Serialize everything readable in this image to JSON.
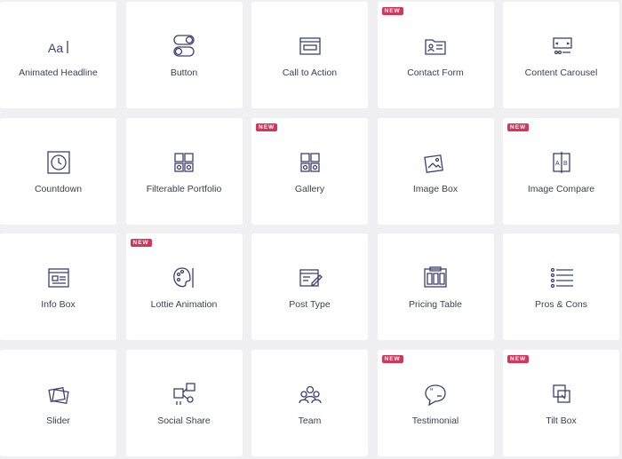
{
  "badge_text": "NEW",
  "accent_color": "#d6345a",
  "widgets": [
    {
      "label": "Animated Headline",
      "icon": "text-aa-icon",
      "new": false
    },
    {
      "label": "Button",
      "icon": "toggle-icon",
      "new": false
    },
    {
      "label": "Call to Action",
      "icon": "window-icon",
      "new": false
    },
    {
      "label": "Contact Form",
      "icon": "contact-folder-icon",
      "new": true
    },
    {
      "label": "Content Carousel",
      "icon": "carousel-icon",
      "new": false
    },
    {
      "label": "Countdown",
      "icon": "timer-icon",
      "new": false
    },
    {
      "label": "Filterable Portfolio",
      "icon": "grid-icon",
      "new": false
    },
    {
      "label": "Gallery",
      "icon": "gallery-grid-icon",
      "new": true
    },
    {
      "label": "Image Box",
      "icon": "image-icon",
      "new": false
    },
    {
      "label": "Image Compare",
      "icon": "compare-icon",
      "new": true
    },
    {
      "label": "Info Box",
      "icon": "info-window-icon",
      "new": false
    },
    {
      "label": "Lottie Animation",
      "icon": "palette-icon",
      "new": true
    },
    {
      "label": "Post Type",
      "icon": "post-edit-icon",
      "new": false
    },
    {
      "label": "Pricing Table",
      "icon": "pricing-table-icon",
      "new": false
    },
    {
      "label": "Pros & Cons",
      "icon": "list-icon",
      "new": false
    },
    {
      "label": "Slider",
      "icon": "slides-icon",
      "new": false
    },
    {
      "label": "Social Share",
      "icon": "share-icon",
      "new": false
    },
    {
      "label": "Team",
      "icon": "team-icon",
      "new": false
    },
    {
      "label": "Testimonial",
      "icon": "quote-bubble-icon",
      "new": true
    },
    {
      "label": "Tilt Box",
      "icon": "tilt-icon",
      "new": true
    }
  ]
}
